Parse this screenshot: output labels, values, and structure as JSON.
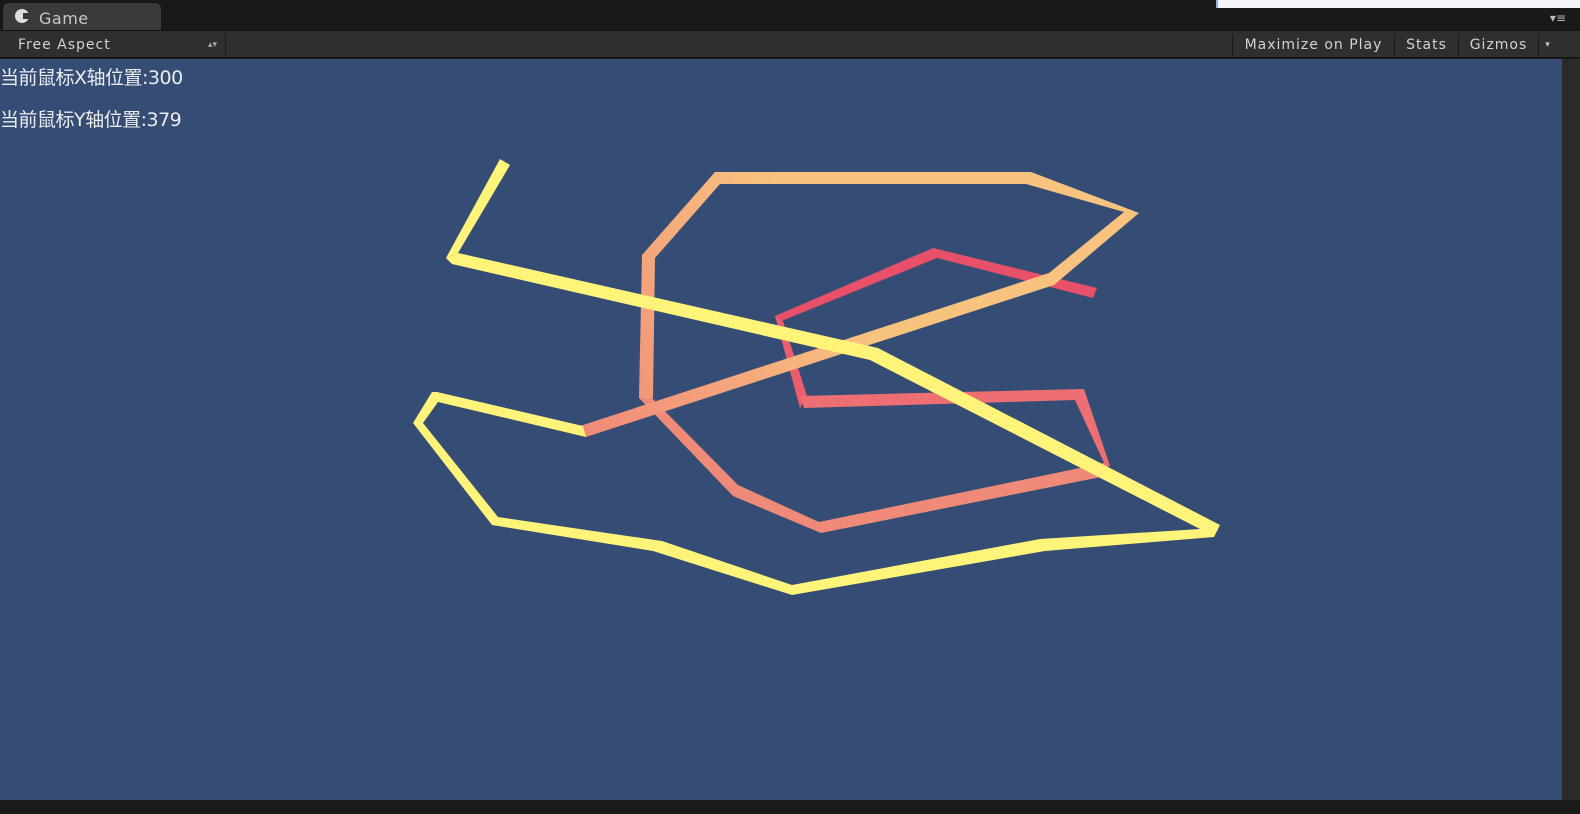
{
  "tab": {
    "icon": "unity-pacman-icon",
    "label": "Game"
  },
  "panel_menu": {
    "icon": "panel-menu-icon",
    "glyph": "▾≡"
  },
  "toolbar": {
    "aspect": "Free Aspect",
    "aspect_arrows": "▴▾",
    "maximize_on_play": "Maximize on Play",
    "stats": "Stats",
    "gizmos": "Gizmos",
    "gizmos_arrow": "▾"
  },
  "overlay": {
    "mouse_x_label": "当前鼠标X轴位置:300",
    "mouse_y_label": "当前鼠标Y轴位置:379"
  },
  "colors": {
    "viewport_background": "#354d74",
    "line_yellow": "#fff47a",
    "line_peach": "#f8c27f",
    "line_salmon": "#f08a78",
    "line_pink": "#e8506a"
  }
}
